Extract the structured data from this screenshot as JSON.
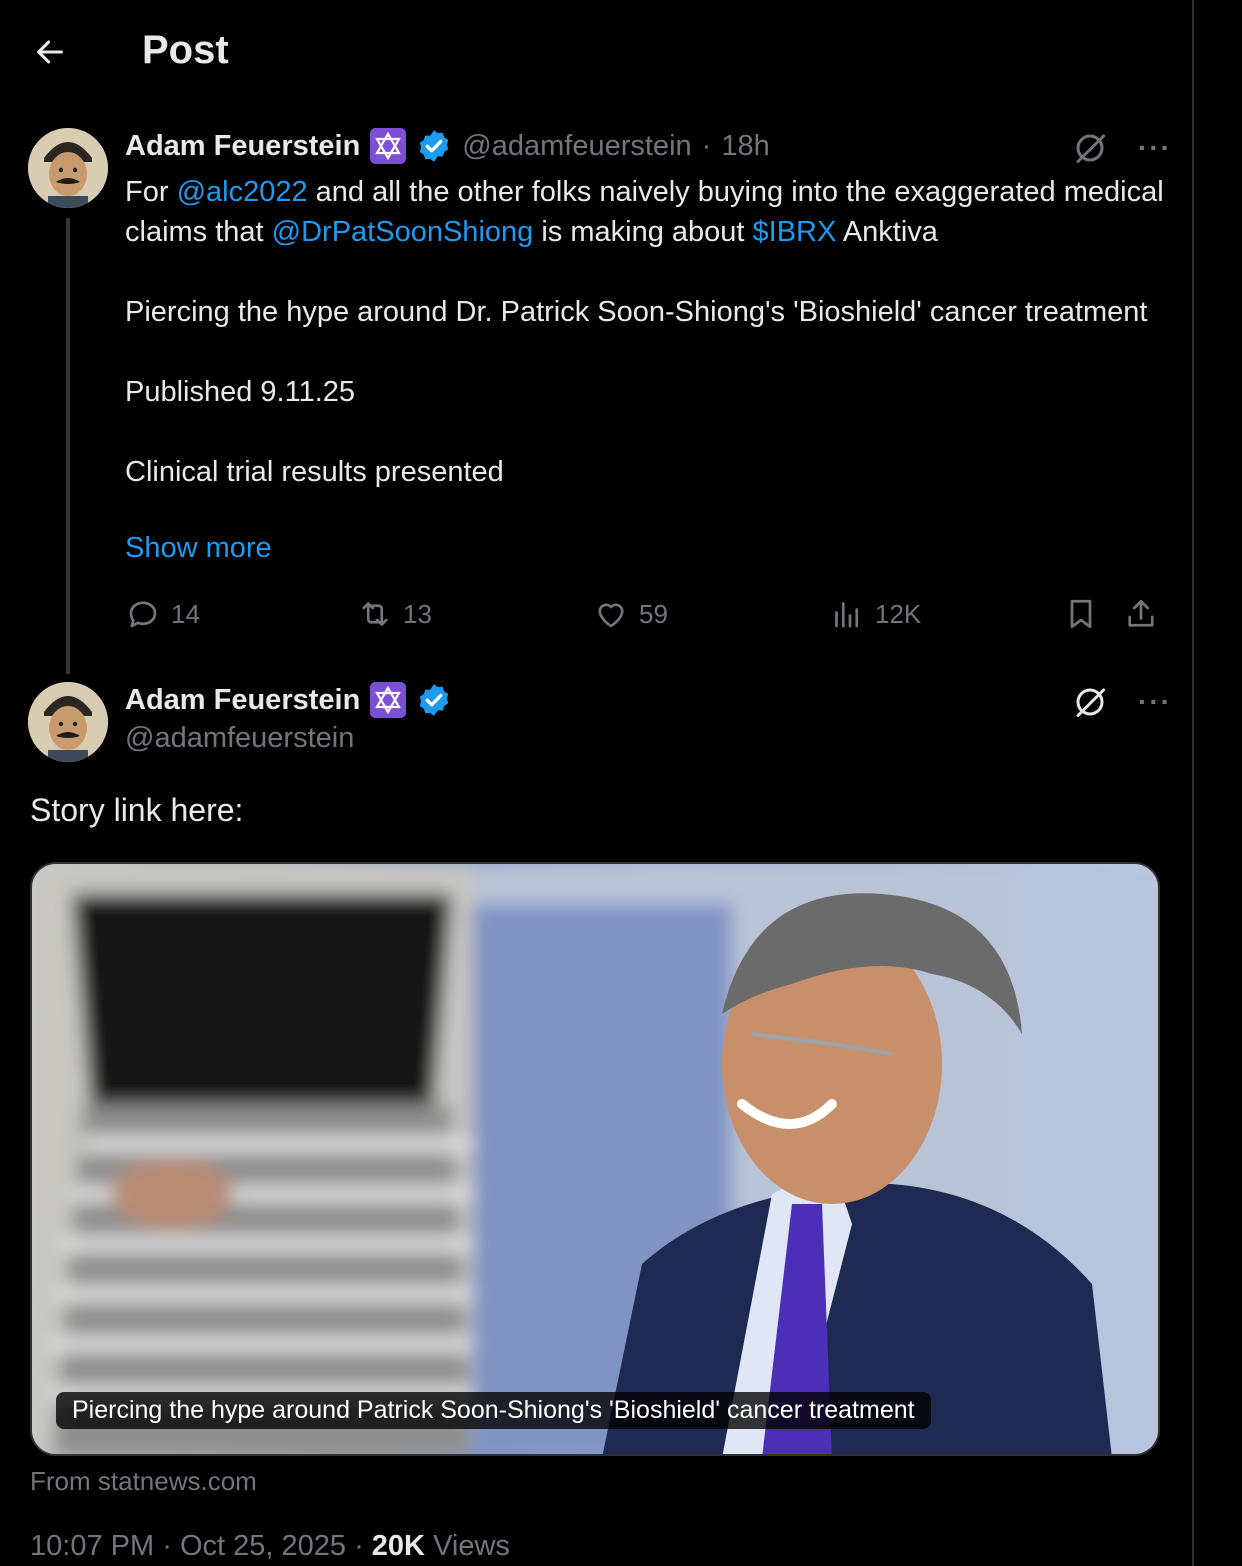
{
  "header": {
    "title": "Post"
  },
  "tweet1": {
    "author_name": "Adam Feuerstein",
    "handle": "@adamfeuerstein",
    "sep": "·",
    "time": "18h",
    "text_for": "For",
    "mention1": "@alc2022",
    "text_mid1": "and all the other folks naively buying into the exaggerated medical claims that",
    "mention2": "@DrPatSoonShiong",
    "text_mid2": "is making about",
    "cashtag": "$IBRX",
    "text_end": "Anktiva",
    "para2": "Piercing the hype around Dr. Patrick Soon-Shiong's 'Bioshield' cancer treatment",
    "para3": "Published 9.11.25",
    "para4": "Clinical trial results presented",
    "show_more": "Show more",
    "replies": "14",
    "reposts": "13",
    "likes": "59",
    "views": "12K"
  },
  "tweet2": {
    "author_name": "Adam Feuerstein",
    "handle": "@adamfeuerstein",
    "text": "Story link here:",
    "card_caption": "Piercing the hype around Patrick Soon-Shiong's 'Bioshield' cancer treatment",
    "card_source": "From statnews.com",
    "time": "10:07 PM",
    "sep": "·",
    "date": "Oct 25, 2025",
    "views_count": "20K",
    "views_label": "Views"
  },
  "icons": {
    "back": "arrow-left-icon",
    "grok": "grok-icon",
    "more": "more-icon",
    "reply": "reply-icon",
    "repost": "repost-icon",
    "like": "like-icon",
    "views": "views-icon",
    "bookmark": "bookmark-icon",
    "share": "share-icon"
  },
  "colors": {
    "accent": "#1d9bf0",
    "muted": "#71767b",
    "text": "#e7e9ea",
    "background": "#000000"
  }
}
